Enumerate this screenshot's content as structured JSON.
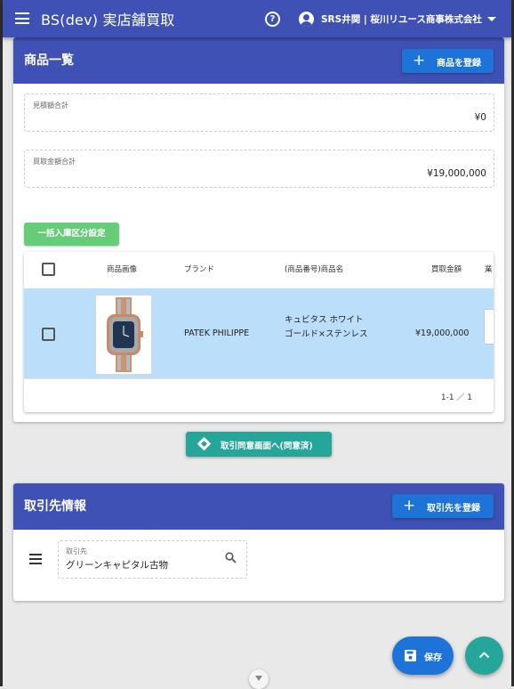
{
  "app": {
    "title": "BS(dev) 実店舗買取",
    "user": "SRS井関 | 桜川リユース商事株式会社"
  },
  "products_card": {
    "title": "商品一覧",
    "register_button": "商品を登録",
    "estimate_total_label": "見積額合計",
    "estimate_total_value": "¥0",
    "purchase_total_label": "買取金額合計",
    "purchase_total_value": "¥19,000,000",
    "batch_button": "一括入庫区分設定",
    "table": {
      "headers": [
        "商品画像",
        "ブランド",
        "(商品番号)商品名",
        "買取金額",
        "業"
      ],
      "rows": [
        {
          "brand": "PATEK PHILIPPE",
          "name": "キュビタス ホワイトゴールド×ステンレス",
          "price": "¥19,000,000"
        }
      ],
      "pagination": "1-1 ／ 1"
    }
  },
  "agree_button": "取引同意画面へ(同意済)",
  "partner_card": {
    "title": "取引先情報",
    "register_button": "取引先を登録",
    "field_label": "取引先",
    "field_value": "グリーンキャピタル古物"
  },
  "save_button": "保存",
  "colors": {
    "primary": "#3f51b5",
    "button_blue": "#1e73d9",
    "teal": "#26a69a",
    "green": "#66cc7a",
    "selected_row": "#bbdefb"
  }
}
